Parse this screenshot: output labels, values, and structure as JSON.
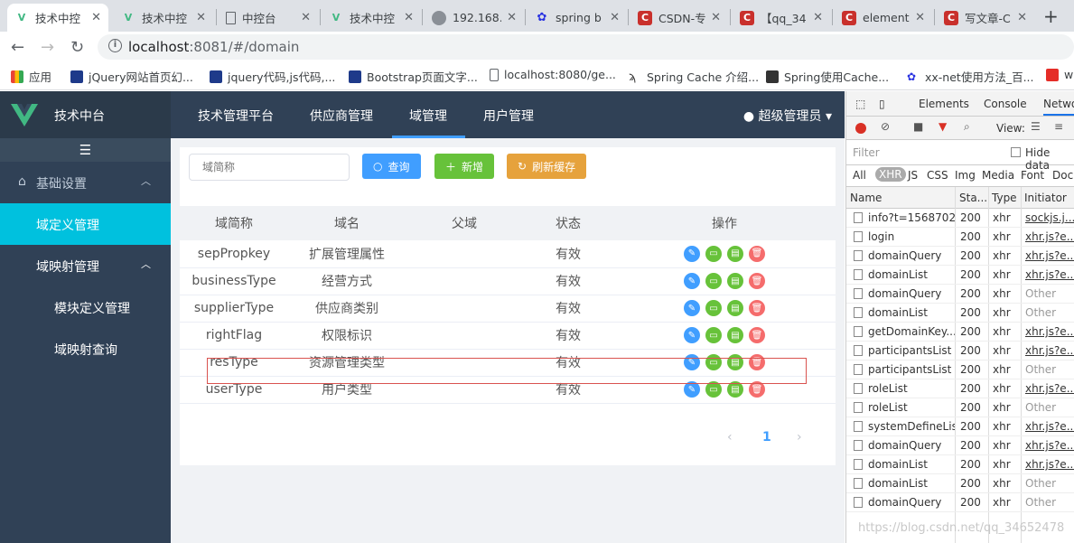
{
  "browser": {
    "tabs": [
      {
        "title": "技术中控",
        "icon": "vue-icon"
      },
      {
        "title": "技术中控",
        "icon": "vue-icon"
      },
      {
        "title": "中控台",
        "icon": "page-icon"
      },
      {
        "title": "技术中控",
        "icon": "vue-icon"
      },
      {
        "title": "192.168.",
        "icon": "cloud-icon"
      },
      {
        "title": "spring b",
        "icon": "baidu-icon"
      },
      {
        "title": "CSDN-专",
        "icon": "csdn-icon"
      },
      {
        "title": "【qq_34",
        "icon": "csdn-icon"
      },
      {
        "title": "element",
        "icon": "csdn-icon"
      },
      {
        "title": "写文章-C",
        "icon": "csdn-icon"
      }
    ],
    "url_host": "localhost",
    "url_rest": ":8081/#/domain",
    "bookmarks": [
      "应用",
      "jQuery网站首页幻...",
      "jquery代码,js代码,...",
      "Bootstrap页面文字...",
      "localhost:8080/ge...",
      "Spring Cache 介绍...",
      "Spring使用Cache...",
      "xx-net使用方法_百...",
      "w"
    ]
  },
  "app": {
    "brand": "技术中台",
    "sidebar": {
      "group1": "基础设置",
      "item_domain_def": "域定义管理",
      "group2": "域映射管理",
      "item_module_def": "模块定义管理",
      "item_domain_query": "域映射查询"
    },
    "topnav": [
      "技术管理平台",
      "供应商管理",
      "域管理",
      "用户管理"
    ],
    "user": "超级管理员",
    "search_placeholder": "域简称",
    "buttons": {
      "query": "查询",
      "add": "新增",
      "refresh": "刷新缓存"
    },
    "table": {
      "headers": [
        "域简称",
        "域名",
        "父域",
        "状态",
        "操作"
      ],
      "rows": [
        {
          "code": "sepPropkey",
          "name": "扩展管理属性",
          "parent": "",
          "status": "有效"
        },
        {
          "code": "businessType",
          "name": "经营方式",
          "parent": "",
          "status": "有效"
        },
        {
          "code": "supplierType",
          "name": "供应商类别",
          "parent": "",
          "status": "有效"
        },
        {
          "code": "rightFlag",
          "name": "权限标识",
          "parent": "",
          "status": "有效"
        },
        {
          "code": "resType",
          "name": "资源管理类型",
          "parent": "",
          "status": "有效"
        },
        {
          "code": "userType",
          "name": "用户类型",
          "parent": "",
          "status": "有效"
        }
      ]
    },
    "pager": {
      "prev": "‹",
      "page": "1",
      "next": "›"
    }
  },
  "devtools": {
    "tabs": [
      "Elements",
      "Console",
      "Netwo"
    ],
    "filter_placeholder": "Filter",
    "hide_data": "Hide data",
    "view_label": "View:",
    "types": [
      "All",
      "XHR",
      "JS",
      "CSS",
      "Img",
      "Media",
      "Font",
      "Doc"
    ],
    "columns": [
      "Name",
      "Sta...",
      "Type",
      "Initiator"
    ],
    "requests": [
      {
        "name": "info?t=1568702...",
        "status": "200",
        "type": "xhr",
        "initiator": "sockjs.j..."
      },
      {
        "name": "login",
        "status": "200",
        "type": "xhr",
        "initiator": "xhr.js?e..."
      },
      {
        "name": "domainQuery",
        "status": "200",
        "type": "xhr",
        "initiator": "xhr.js?e..."
      },
      {
        "name": "domainList",
        "status": "200",
        "type": "xhr",
        "initiator": "xhr.js?e..."
      },
      {
        "name": "domainQuery",
        "status": "200",
        "type": "xhr",
        "initiator": "Other"
      },
      {
        "name": "domainList",
        "status": "200",
        "type": "xhr",
        "initiator": "Other"
      },
      {
        "name": "getDomainKey...",
        "status": "200",
        "type": "xhr",
        "initiator": "xhr.js?e..."
      },
      {
        "name": "participantsList",
        "status": "200",
        "type": "xhr",
        "initiator": "xhr.js?e..."
      },
      {
        "name": "participantsList",
        "status": "200",
        "type": "xhr",
        "initiator": "Other"
      },
      {
        "name": "roleList",
        "status": "200",
        "type": "xhr",
        "initiator": "xhr.js?e..."
      },
      {
        "name": "roleList",
        "status": "200",
        "type": "xhr",
        "initiator": "Other"
      },
      {
        "name": "systemDefineList",
        "status": "200",
        "type": "xhr",
        "initiator": "xhr.js?e..."
      },
      {
        "name": "domainQuery",
        "status": "200",
        "type": "xhr",
        "initiator": "xhr.js?e..."
      },
      {
        "name": "domainList",
        "status": "200",
        "type": "xhr",
        "initiator": "xhr.js?e..."
      },
      {
        "name": "domainList",
        "status": "200",
        "type": "xhr",
        "initiator": "Other"
      },
      {
        "name": "domainQuery",
        "status": "200",
        "type": "xhr",
        "initiator": "Other"
      }
    ],
    "watermark": "https://blog.csdn.net/qq_34652478"
  },
  "colors": {
    "sidebar": "#304156",
    "active": "#00c1de",
    "primary": "#409eff",
    "success": "#67c23a",
    "warning": "#e6a23c",
    "danger": "#f56c6c"
  }
}
